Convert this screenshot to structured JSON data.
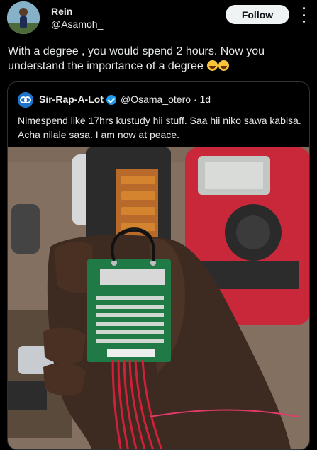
{
  "header": {
    "display_name": "Rein",
    "handle": "@Asamoh_",
    "follow_label": "Follow"
  },
  "tweet": {
    "text": "With a degree , you would spend 2 hours. Now you understand the importance of a degree"
  },
  "quote": {
    "display_name": "Sir-Rap-A-Lot",
    "handle": "@Osama_otero",
    "time": "· 1d",
    "text": "Nimespend like 17hrs kustudy hii stuff. Saa hii niko sawa kabisa. Acha nilale sasa. I am now at peace."
  },
  "icons": {
    "more": "more-vertical-icon",
    "verified": "verified-badge-icon",
    "emoji": "rolling-on-floor-laughing-emoji"
  }
}
